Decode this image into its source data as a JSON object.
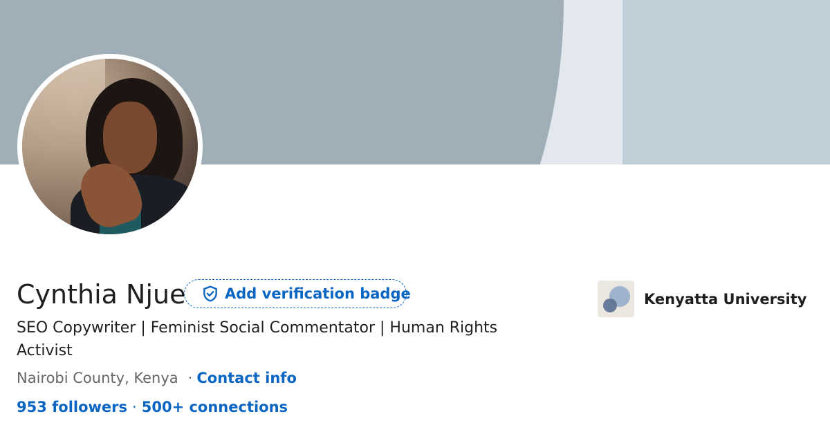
{
  "profile": {
    "name": "Cynthia Njue",
    "verification_button": "Add verification badge",
    "headline": "SEO Copywriter | Feminist Social Commentator | Human Rights Activist",
    "location": "Nairobi County, Kenya",
    "separator": "·",
    "contact_info": "Contact info",
    "followers": "953 followers",
    "connections": "500+ connections"
  },
  "education": {
    "name": "Kenyatta University"
  },
  "colors": {
    "link": "#0a66c2",
    "banner_dark": "#9faeb7",
    "banner_light": "#e2e8ee",
    "banner_right": "#bfd0d9"
  },
  "icons": {
    "verification": "shield-check-icon",
    "education_logo": "university-logo"
  }
}
